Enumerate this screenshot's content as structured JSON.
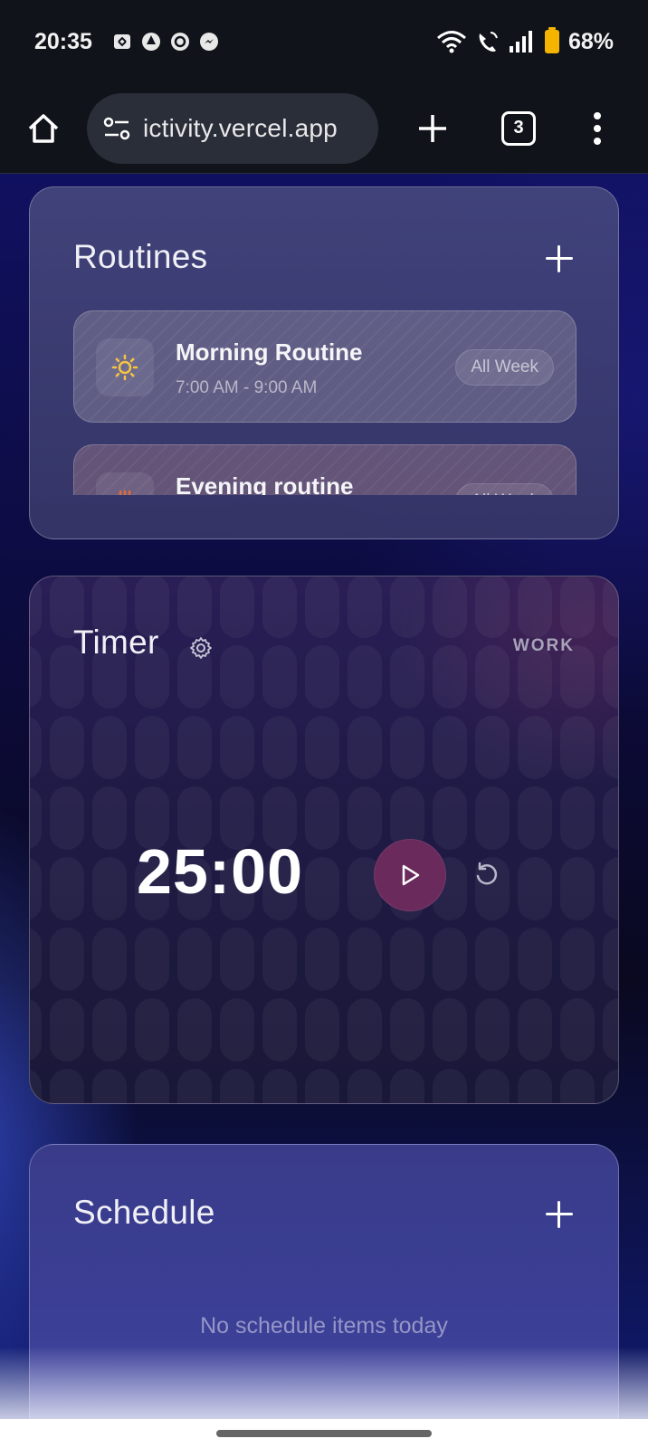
{
  "status_bar": {
    "time": "20:35",
    "battery": "68%",
    "notification_icons": [
      "sync-icon",
      "aperture-icon",
      "notification-icon",
      "messenger-icon"
    ],
    "right_icons": [
      "wifi-icon",
      "wifi-call-icon",
      "signal-icon",
      "battery-icon"
    ]
  },
  "browser": {
    "url": "ictivity.vercel.app",
    "tab_count": "3"
  },
  "routines": {
    "title": "Routines",
    "items": [
      {
        "name": "Morning Routine",
        "time": "7:00 AM - 9:00 AM",
        "badge": "All Week",
        "icon": "sun-icon",
        "icon_color": "#f5c542"
      },
      {
        "name": "Evening routine",
        "time": "",
        "badge": "All Week",
        "icon": "evening-icon",
        "icon_color": "#e06a3a"
      }
    ]
  },
  "timer": {
    "title": "Timer",
    "mode": "WORK",
    "display": "25:00",
    "accent": "#6a2a5c"
  },
  "schedule": {
    "title": "Schedule",
    "empty_text": "No schedule items today"
  }
}
